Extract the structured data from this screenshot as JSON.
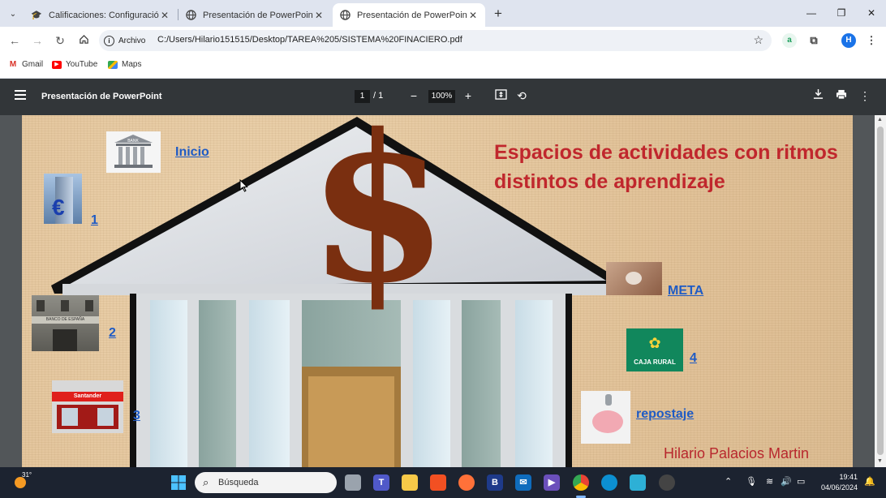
{
  "tabs": [
    {
      "label": "Calificaciones: Configuración",
      "icon": "graduation-cap-icon"
    },
    {
      "label": "Presentación de PowerPoint",
      "icon": "globe-icon"
    },
    {
      "label": "Presentación de PowerPoint",
      "icon": "globe-icon"
    }
  ],
  "window": {
    "minimize": "—",
    "restore": "❐",
    "close": "✕"
  },
  "toolbar": {
    "chip_label": "Archivo",
    "url": "C:/Users/Hilario151515/Desktop/TAREA%205/SISTEMA%20FINACIERO.pdf",
    "profile_initial": "H"
  },
  "bookmarks": [
    {
      "label": "Gmail"
    },
    {
      "label": "YouTube"
    },
    {
      "label": "Maps"
    }
  ],
  "pdf": {
    "title": "Presentación de PowerPoint",
    "current_page": "1",
    "total_pages": "1",
    "zoom": "100%"
  },
  "slide": {
    "title": "Espacios de actividades con ritmos distintos de aprendizaje",
    "links": {
      "inicio": "Inicio",
      "one": "1",
      "two": "2",
      "three": "3",
      "four": "4",
      "meta": "META",
      "repostaje": "repostaje"
    },
    "bank_sign": "BANK",
    "banco_text": "BANCO DE ESPAÑA",
    "santander_text": "Santander",
    "caja_rural_text": "CAJA RURAL",
    "dollar": "$",
    "author": "Hilario Palacios Martin"
  },
  "taskbar": {
    "temperature": "31°",
    "search_placeholder": "Búsqueda",
    "time": "19:41",
    "date": "04/06/2024"
  },
  "colors": {
    "slide_title": "#c0272d",
    "link": "#1f5bc4",
    "dollar": "#7a2f10",
    "pdf_bar": "#323639"
  }
}
